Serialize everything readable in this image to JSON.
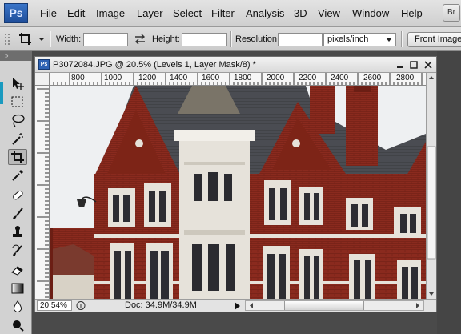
{
  "app": {
    "logo": "Ps",
    "bridge_button": "Br"
  },
  "menu": [
    "File",
    "Edit",
    "Image",
    "Layer",
    "Select",
    "Filter",
    "Analysis",
    "3D",
    "View",
    "Window",
    "Help"
  ],
  "options_bar": {
    "width_label": "Width:",
    "width_value": "",
    "height_label": "Height:",
    "height_value": "",
    "resolution_label": "Resolution:",
    "resolution_value": "",
    "resolution_unit": "pixels/inch",
    "front_image_button": "Front Image"
  },
  "toolbox": {
    "tools": [
      {
        "name": "move-tool",
        "icon": "move-icon"
      },
      {
        "name": "marquee-tool",
        "icon": "marquee-icon"
      },
      {
        "name": "lasso-tool",
        "icon": "lasso-icon"
      },
      {
        "name": "magic-wand-tool",
        "icon": "magic-wand-icon"
      },
      {
        "name": "crop-tool",
        "icon": "crop-icon",
        "active": true
      },
      {
        "name": "eyedropper-tool",
        "icon": "eyedropper-icon"
      },
      {
        "name": "healing-brush-tool",
        "icon": "bandage-icon"
      },
      {
        "name": "brush-tool",
        "icon": "brush-icon"
      },
      {
        "name": "clone-stamp-tool",
        "icon": "stamp-icon"
      },
      {
        "name": "history-brush-tool",
        "icon": "history-brush-icon"
      },
      {
        "name": "eraser-tool",
        "icon": "eraser-icon"
      },
      {
        "name": "gradient-tool",
        "icon": "gradient-icon"
      },
      {
        "name": "blur-tool",
        "icon": "drop-icon"
      },
      {
        "name": "dodge-tool",
        "icon": "dodge-icon"
      }
    ]
  },
  "document": {
    "title": "P3072084.JPG @ 20.5% (Levels 1, Layer Mask/8) *",
    "ruler_top_labels": [
      "800",
      "1000",
      "1200",
      "1400",
      "1600",
      "1800",
      "2000",
      "2200",
      "2400",
      "2600",
      "2800"
    ],
    "zoom": "20.54%",
    "doc_size": "Doc: 34.9M/34.9M"
  },
  "colors": {
    "brick": "#8a2a1e",
    "roof": "#4a4c52",
    "stone": "#e6e2da",
    "sky": "#eef0f2"
  }
}
